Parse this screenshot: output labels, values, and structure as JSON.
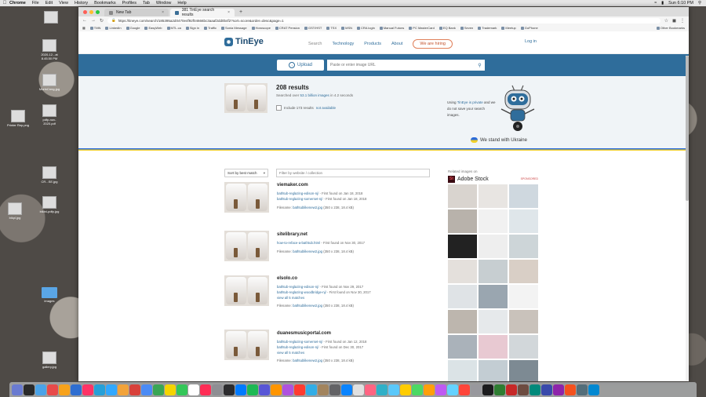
{
  "menubar": {
    "items": [
      "Chrome",
      "File",
      "Edit",
      "View",
      "History",
      "Bookmarks",
      "Profiles",
      "Tab",
      "Window",
      "Help"
    ],
    "clock": "Sun 6:10 PM"
  },
  "desktop_icons": [
    {
      "label": "2020-12...at 8.45.50 PM"
    },
    {
      "label": "MorinCrmg.jpg"
    },
    {
      "label": "Printer Rep.png"
    },
    {
      "label": "pdfp-nov-2020.pdf"
    },
    {
      "label": "CR...SE.jpg"
    },
    {
      "label": "bikini-pdfp.jpg"
    },
    {
      "label": "bikpl.jpg"
    },
    {
      "label": "images"
    },
    {
      "label": "gallery.jpg"
    }
  ],
  "browser": {
    "tabs": [
      {
        "title": "New Tab"
      },
      {
        "title": "381 TinEye search results"
      }
    ],
    "url": "https://tineye.com/search/185395a2d0470e4f92f04666bc3aaaf2dd0b4f2?sort=score&order=desc&page=1",
    "bookmarks": [
      "TMN",
      "LinkedIn",
      "Google",
      "EasyWeb",
      "MTL.ca",
      "Sign in",
      "Traffic",
      "Sonia Message",
      "Horoscope",
      "CRAT Pension",
      "GST/HST",
      "TSX",
      "MSN",
      "CRA login",
      "Manual Futons",
      "PC MasterCard",
      "EQ Bank",
      "Seven",
      "Trademark",
      "Meetup",
      "GoPhone"
    ],
    "other_bookmarks": "Other Bookmarks"
  },
  "header": {
    "logo": "TinEye",
    "nav": [
      "Search",
      "Technology",
      "Products",
      "About"
    ],
    "hiring": "We are hiring",
    "login": "Log in"
  },
  "searchbar": {
    "upload": "Upload",
    "placeholder": "Paste or enter image URL"
  },
  "summary": {
    "count": "208 results",
    "searched_prefix": "Searched over ",
    "searched_bold": "53.1 billion images",
    "searched_suffix": " in 4.2 seconds",
    "include_prefix": "Include 173 results ",
    "include_link": "not available",
    "private_1": "Using ",
    "private_link": "TinEye is private",
    "private_2": " and we do not save your search images.",
    "ukraine": "We stand with Ukraine"
  },
  "controls": {
    "sort": "Sort by best match",
    "filter_placeholder": "Filter by website / collection"
  },
  "results": [
    {
      "site": "viemaker.com",
      "links": [
        {
          "link": "bathtub-reglazing-edison-nj/",
          "found": " - First found on Jan 18, 2018"
        },
        {
          "link": "bathtub-reglazing-somerset-nj/",
          "found": " - First found on Jan 18, 2018"
        }
      ],
      "file_label": "Filename: ",
      "file": "bathtublikenew2.jpg",
      "dims": " (350 x 238, 18.4 kB)"
    },
    {
      "site": "sitelibrary.net",
      "links": [
        {
          "link": "how-to-reface-a-bathtub.html",
          "found": " - First found on Nov 30, 2017"
        }
      ],
      "file_label": "Filename: ",
      "file": "bathtublikenew2.jpg",
      "dims": " (350 x 238, 18.4 kB)"
    },
    {
      "site": "elsolo.co",
      "links": [
        {
          "link": "bathtub-reglazing-edison-nj/",
          "found": " - First found on Nov 29, 2017"
        },
        {
          "link": "bathtub-reglazing-woodbridge-nj/",
          "found": " - First found on Nov 30, 2017"
        }
      ],
      "view": "view all 5 matches",
      "file_label": "Filename: ",
      "file": "bathtublikenew2.jpg",
      "dims": " (350 x 238, 18.4 kB)"
    },
    {
      "site": "duanesmusicportal.com",
      "links": [
        {
          "link": "bathtub-reglazing-somerset-nj/",
          "found": " - First found on Jan 12, 2018"
        },
        {
          "link": "bathtub-reglazing-edison-nj/",
          "found": " - First found on Dec 30, 2017"
        }
      ],
      "view": "view all 5 matches",
      "file_label": "Filename: ",
      "file": "bathtublikenew2.jpg",
      "dims": " (350 x 238, 18.4 kB)"
    }
  ],
  "sidebar": {
    "title": "Related images on",
    "brand": "Adobe Stock",
    "sponsored": "SPONSORED",
    "tile_colors": [
      "#d9d4cf",
      "#e8e5e2",
      "#cfd8df",
      "#b8b2ab",
      "#f1f1f1",
      "#dfe6ea",
      "#222222",
      "#eeeeee",
      "#cdd5d8",
      "#e4e0dc",
      "#c7ced1",
      "#d9cfc6",
      "#dfe3e6",
      "#9aa6b0",
      "#f3f3f3",
      "#bdb6ae",
      "#e6e9eb",
      "#c9c2bb",
      "#aab2ba",
      "#e8c9d2",
      "#d2d7da",
      "#dbe3e6",
      "#c3cdd3",
      "#7d8a93",
      "#e1ddd9",
      "#cfd6da",
      "#eeeeee"
    ]
  }
}
